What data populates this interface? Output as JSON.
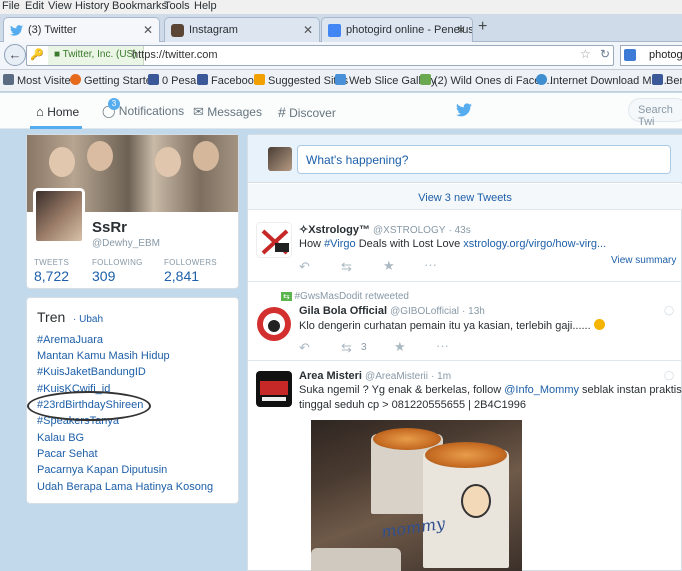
{
  "browser": {
    "menu": [
      "File",
      "Edit",
      "View",
      "History",
      "Bookmarks",
      "Tools",
      "Help"
    ],
    "tabs": [
      {
        "title": "(3) Twitter",
        "icon": "twitter-bird-icon",
        "active": true
      },
      {
        "title": "Instagram",
        "icon": "instagram-icon",
        "active": false
      },
      {
        "title": "photogird online - Penelus...",
        "icon": "google-icon",
        "active": false
      }
    ],
    "new_tab_glyph": "+",
    "identity": "Twitter, Inc. (US)",
    "url": "https://twitter.com",
    "search_value": "photogi",
    "bookmarks": [
      {
        "label": "Most Visited",
        "color": "#5a6b82"
      },
      {
        "label": "Getting Started",
        "color": "#e56a1c"
      },
      {
        "label": "0 Pesan",
        "color": "#3b5998"
      },
      {
        "label": "Facebook",
        "color": "#3b5998"
      },
      {
        "label": "Suggested Sites",
        "color": "#f2a000"
      },
      {
        "label": "Web Slice Gallery",
        "color": "#4a90d9"
      },
      {
        "label": "(2) Wild Ones di Faceb...",
        "color": "#6aa84f"
      },
      {
        "label": "Internet Download Ma...",
        "color": "#3e8ed0"
      },
      {
        "label": "Bera",
        "color": "#3b5998"
      }
    ]
  },
  "twitter": {
    "nav": {
      "home": "Home",
      "notifications": "Notifications",
      "notif_count": "3",
      "messages": "Messages",
      "discover": "Discover",
      "search_placeholder": "Search Twi"
    },
    "profile": {
      "name": "SsRr",
      "handle": "@Dewhy_EBM",
      "stats": [
        {
          "label": "TWEETS",
          "value": "8,722"
        },
        {
          "label": "FOLLOWING",
          "value": "309"
        },
        {
          "label": "FOLLOWERS",
          "value": "2,841"
        }
      ]
    },
    "trends": {
      "title": "Tren",
      "change": "· Ubah",
      "items": [
        "#AremaJuara",
        "Mantan Kamu Masih Hidup",
        "#KuisJaketBandungID",
        "#KuisKCwifi_id",
        "#23rdBirthdayShireen",
        "#SpeakersTanya",
        "Kalau BG",
        "Pacar Sehat",
        "Pacarnya Kapan Diputusin",
        "Udah Berapa Lama Hatinya Kosong"
      ]
    },
    "compose_placeholder": "What's happening?",
    "new_tweets": "View 3 new Tweets",
    "tweets": [
      {
        "name": "✧Xstrology™",
        "handle": "@XSTROLOGY",
        "time": "· 43s",
        "text_pre": "How ",
        "text_hashtag": "#Virgo",
        "text_mid": " Deals with Lost Love ",
        "text_link": "xstrology.org/virgo/how-virg...",
        "view_summary": "View summary"
      },
      {
        "retweeted_by": "#GwsMasDodit retweeted",
        "name": "Gila Bola Official",
        "handle": "@GIBOLofficial",
        "time": "· 13h",
        "text": "Klo dengerin curhatan pemain itu ya kasian, terlebih gaji......",
        "retweet_count": "3"
      },
      {
        "name": "Area Misteri",
        "handle": "@AreaMisterii",
        "time": "· 1m",
        "line1_pre": "Suka ngemil ? Yg enak & berkelas, follow ",
        "line1_mention": "@Info_Mommy",
        "line1_post": " seblak instan praktis",
        "line2": "tinggal seduh cp > 081220555655 | 2B4C1996",
        "image_text": "mommy"
      }
    ]
  },
  "colors": {
    "twitter_blue": "#55acee",
    "link_blue": "#1d5fa8",
    "page_bg": "#c2d9eb"
  }
}
